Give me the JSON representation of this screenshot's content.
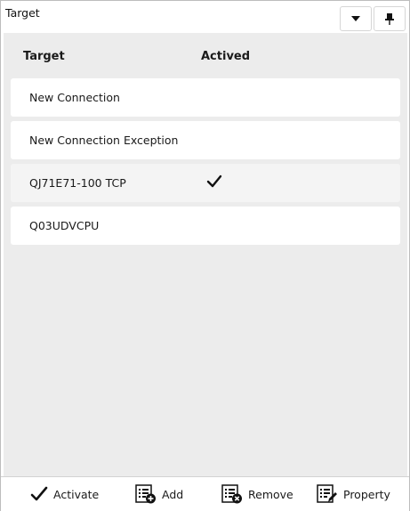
{
  "panel": {
    "title": "Target"
  },
  "table": {
    "headers": {
      "target": "Target",
      "active": "Actived"
    },
    "rows": [
      {
        "name": "New Connection",
        "active": false
      },
      {
        "name": "New Connection Exception",
        "active": false
      },
      {
        "name": "QJ71E71-100 TCP",
        "active": true
      },
      {
        "name": "Q03UDVCPU",
        "active": false
      }
    ]
  },
  "toolbar": {
    "activate_label": "Activate",
    "add_label": "Add",
    "remove_label": "Remove",
    "property_label": "Property"
  },
  "icons": {
    "dropdown": "caret-down-icon",
    "pin": "pin-icon",
    "check": "checkmark-icon",
    "add": "list-add-icon",
    "remove": "list-remove-icon",
    "property": "list-edit-icon"
  }
}
